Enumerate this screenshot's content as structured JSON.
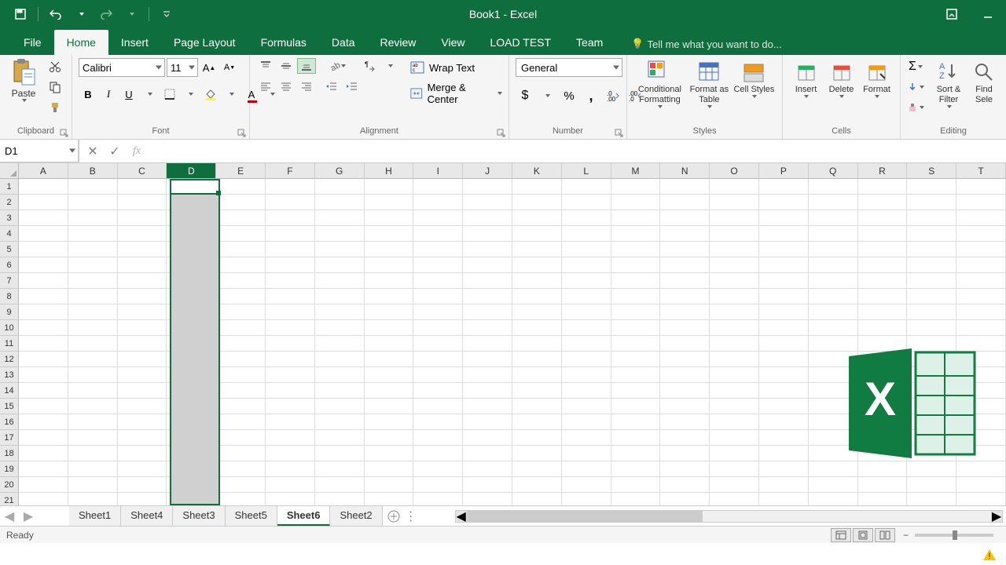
{
  "title": "Book1 - Excel",
  "qat": {
    "save": "Save",
    "undo": "Undo",
    "redo": "Redo"
  },
  "tabs": [
    "File",
    "Home",
    "Insert",
    "Page Layout",
    "Formulas",
    "Data",
    "Review",
    "View",
    "LOAD TEST",
    "Team"
  ],
  "active_tab": "Home",
  "tellme": "Tell me what you want to do...",
  "ribbon": {
    "clipboard": {
      "label": "Clipboard",
      "paste": "Paste"
    },
    "font": {
      "label": "Font",
      "name": "Calibri",
      "size": "11"
    },
    "alignment": {
      "label": "Alignment",
      "wrap": "Wrap Text",
      "merge": "Merge & Center"
    },
    "number": {
      "label": "Number",
      "format": "General"
    },
    "styles": {
      "label": "Styles",
      "cond": "Conditional Formatting",
      "table": "Format as Table",
      "cell": "Cell Styles"
    },
    "cells": {
      "label": "Cells",
      "insert": "Insert",
      "delete": "Delete",
      "format": "Format"
    },
    "editing": {
      "label": "Editing",
      "sort": "Sort & Filter",
      "find": "Find Sele"
    }
  },
  "namebox": "D1",
  "columns": [
    "A",
    "B",
    "C",
    "D",
    "E",
    "F",
    "G",
    "H",
    "I",
    "J",
    "K",
    "L",
    "M",
    "N",
    "O",
    "P",
    "Q",
    "R",
    "S",
    "T"
  ],
  "selected_col": "D",
  "rows": 21,
  "sheets": [
    "Sheet1",
    "Sheet4",
    "Sheet3",
    "Sheet5",
    "Sheet6",
    "Sheet2"
  ],
  "active_sheet": "Sheet6",
  "status": "Ready"
}
